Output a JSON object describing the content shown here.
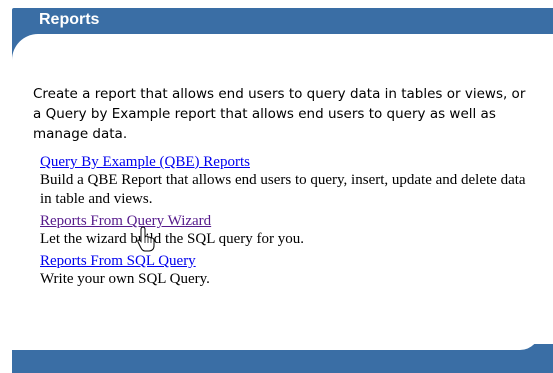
{
  "header": {
    "title": "Reports"
  },
  "intro_text": "Create a report that allows end users to query data in tables or views, or a Query by Example report that allows end users to query as well as manage data.",
  "items": [
    {
      "link": "Query By Example (QBE) Reports",
      "description": "Build a QBE Report that allows end users to query, insert, update and delete data in table and views."
    },
    {
      "link": "Reports From Query Wizard",
      "description": "Let the wizard build the SQL query for you."
    },
    {
      "link": "Reports From SQL Query",
      "description": "Write your own SQL Query."
    }
  ],
  "colors": {
    "banner": "#3a6ea5",
    "link": "#0000ee",
    "visited_link": "#551a8b"
  },
  "icons": {
    "cursor": "hand-pointer-icon"
  }
}
